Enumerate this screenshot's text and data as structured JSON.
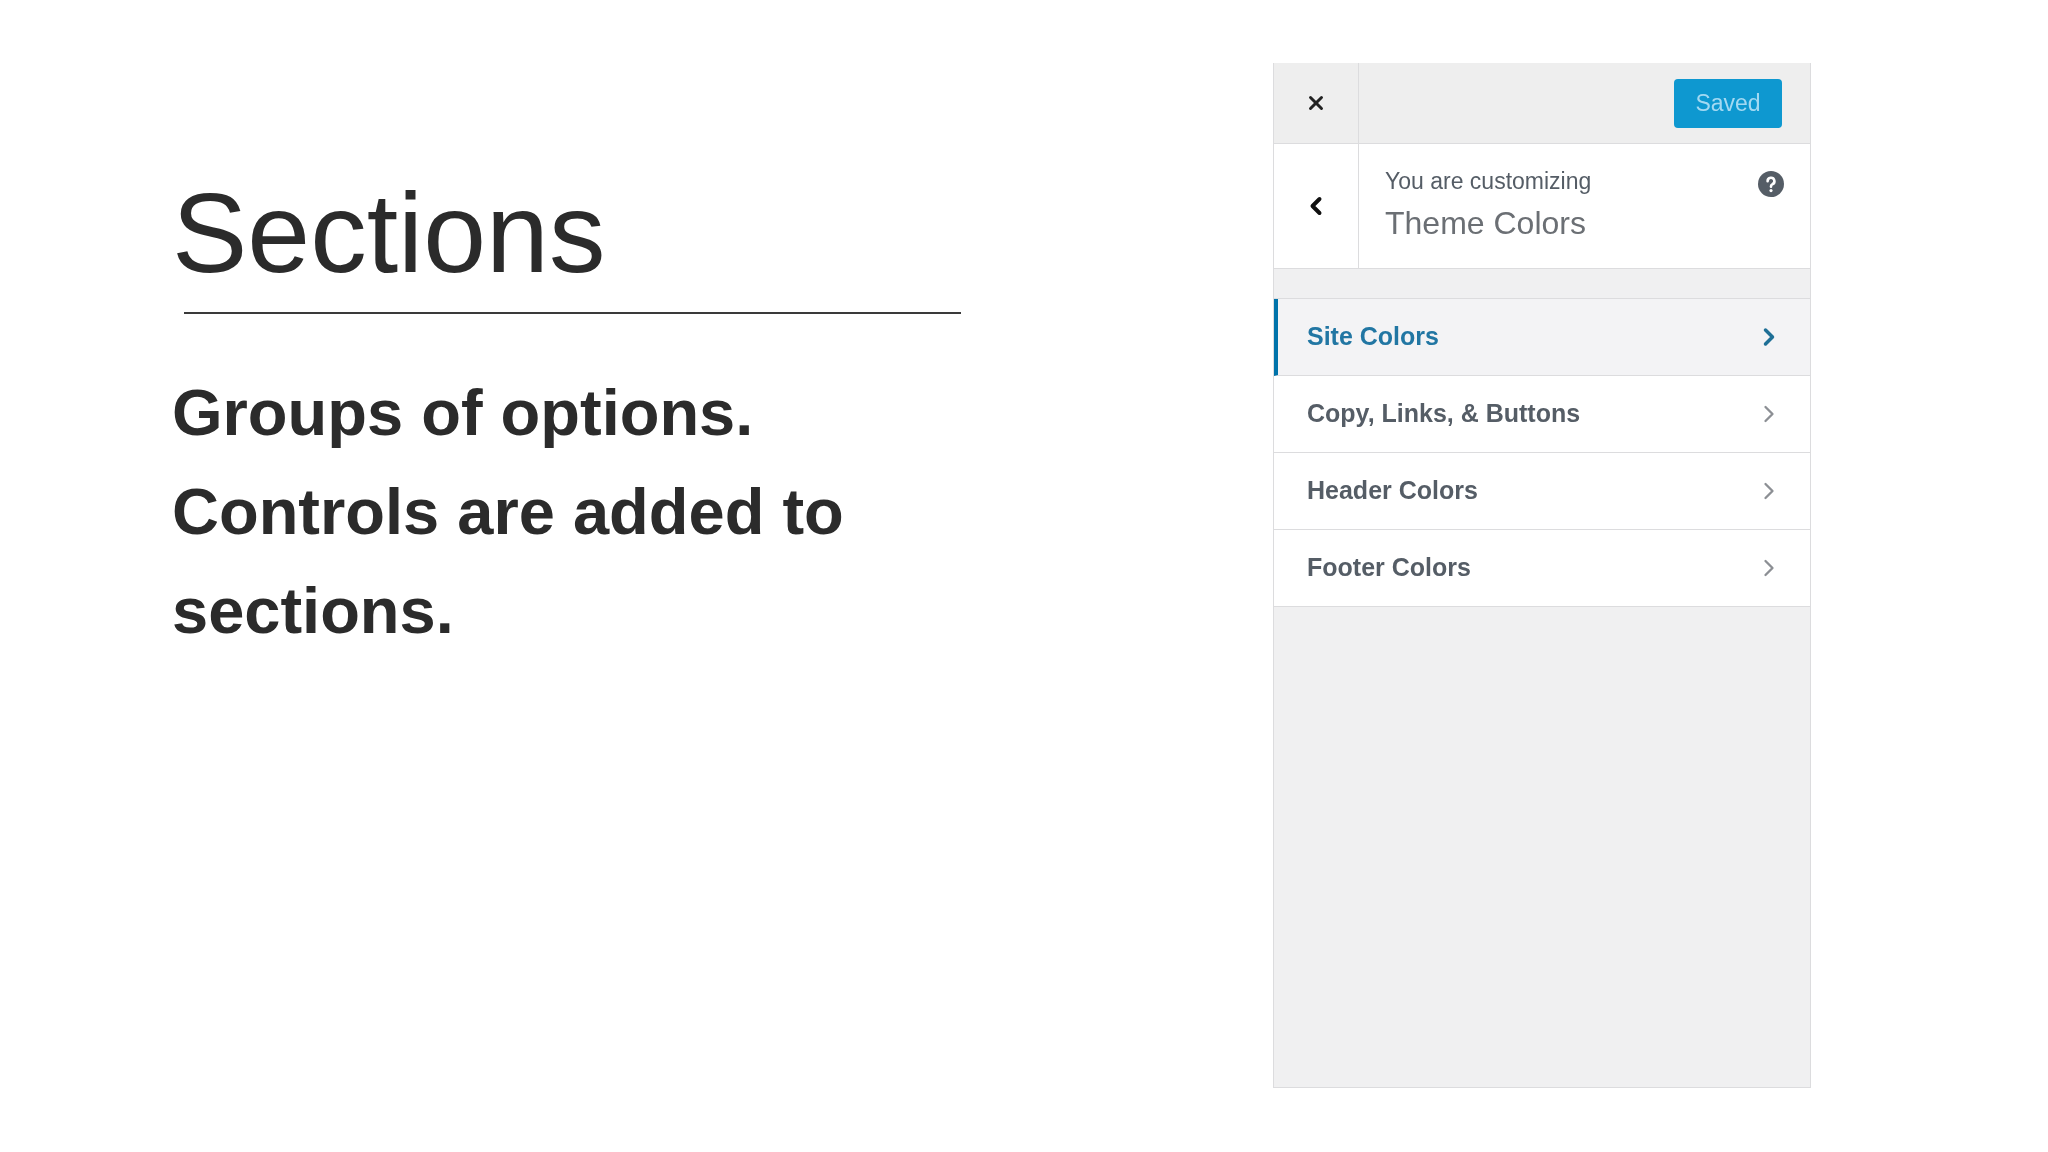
{
  "slide": {
    "title": "Sections",
    "body": "Groups of options. Controls are added to sections."
  },
  "customizer": {
    "save_button": "Saved",
    "info": {
      "label": "You are customizing",
      "title": "Theme Colors"
    },
    "sections": [
      {
        "label": "Site Colors",
        "selected": true
      },
      {
        "label": "Copy, Links, & Buttons",
        "selected": false
      },
      {
        "label": "Header Colors",
        "selected": false
      },
      {
        "label": "Footer Colors",
        "selected": false
      }
    ]
  }
}
